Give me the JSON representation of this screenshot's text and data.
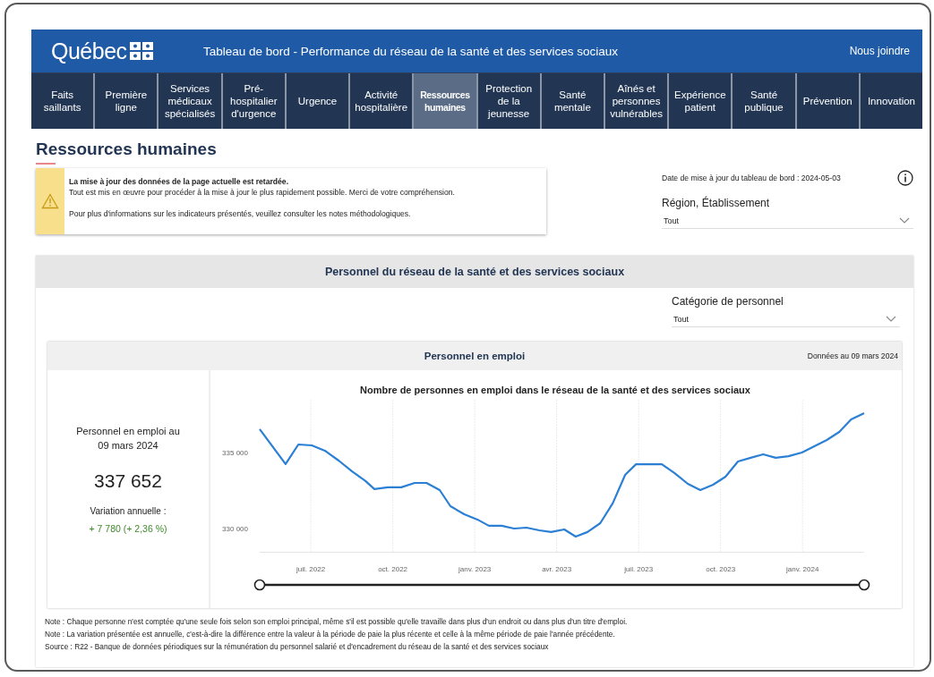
{
  "header": {
    "logo": "Québec",
    "title": "Tableau de bord - Performance du réseau de la santé et des services sociaux",
    "contact_link": "Nous joindre"
  },
  "nav": [
    {
      "label": "Faits saillants",
      "selected": false
    },
    {
      "label": "Première ligne",
      "selected": false
    },
    {
      "label": "Services médicaux spécialisés",
      "selected": false
    },
    {
      "label": "Pré-hospitalier d'urgence",
      "selected": false
    },
    {
      "label": "Urgence",
      "selected": false
    },
    {
      "label": "Activité hospitalière",
      "selected": false
    },
    {
      "label": "Ressources humaines",
      "selected": true
    },
    {
      "label": "Protection de la jeunesse",
      "selected": false
    },
    {
      "label": "Santé mentale",
      "selected": false
    },
    {
      "label": "Aînés et personnes vulnérables",
      "selected": false
    },
    {
      "label": "Expérience patient",
      "selected": false
    },
    {
      "label": "Santé publique",
      "selected": false
    },
    {
      "label": "Prévention",
      "selected": false
    },
    {
      "label": "Innovation",
      "selected": false
    }
  ],
  "page_title": "Ressources humaines",
  "alert": {
    "heading": "La mise à jour des données de la page actuelle est retardée.",
    "lines": [
      "Tout est mis en œuvre pour procéder à la mise à jour le plus rapidement possible. Merci de votre compréhension.",
      "Pour plus d'informations sur les indicateurs présentés, veuillez consulter les notes méthodologiques."
    ]
  },
  "update_date": "Date de mise à jour du tableau de bord : 2024-05-03",
  "region_filter": {
    "label": "Région, Établissement",
    "value": "Tout"
  },
  "section": {
    "title": "Personnel du réseau de la santé et des services sociaux",
    "category_filter": {
      "label": "Catégorie de personnel",
      "value": "Tout"
    },
    "panel": {
      "title": "Personnel en emploi",
      "data_date": "Données au 09 mars 2024",
      "kpi": {
        "label": "Personnel en emploi au 09 mars 2024",
        "value": "337 652",
        "variation_label": "Variation annuelle :",
        "variation": "+ 7 780 (+ 2,36 %)"
      },
      "chart_data": {
        "type": "line",
        "title": "Nombre de personnes en emploi dans le réseau de la santé et des services sociaux",
        "x": [
          2022.344,
          2022.423,
          2022.462,
          2022.503,
          2022.543,
          2022.585,
          2022.626,
          2022.667,
          2022.694,
          2022.735,
          2022.776,
          2022.817,
          2022.853,
          2022.893,
          2022.926,
          2022.968,
          2023.008,
          2023.043,
          2023.082,
          2023.12,
          2023.158,
          2023.197,
          2023.233,
          2023.273,
          2023.308,
          2023.344,
          2023.383,
          2023.421,
          2023.459,
          2023.492,
          2023.533,
          2023.571,
          2023.609,
          2023.65,
          2023.688,
          2023.727,
          2023.765,
          2023.803,
          2023.842,
          2023.88,
          2023.918,
          2023.957,
          2023.998,
          2024.036,
          2024.074,
          2024.112,
          2024.148,
          2024.188
        ],
        "series": [
          {
            "color": "#2b7fd4",
            "values": [
              336600,
              334300,
              335590,
              335530,
              335180,
              334530,
              333820,
              333180,
              332650,
              332770,
              332770,
              333060,
              333060,
              332590,
              331530,
              331000,
              330650,
              330240,
              330240,
              330060,
              330120,
              329940,
              329830,
              330000,
              329530,
              329830,
              330410,
              331710,
              333590,
              334290,
              334290,
              334290,
              333710,
              333000,
              332590,
              332940,
              333470,
              334470,
              334710,
              334940,
              334710,
              334820,
              335060,
              335470,
              335880,
              336410,
              337230,
              337652
            ]
          }
        ],
        "grid": true,
        "xlim": [
          2022.344,
          2024.188
        ],
        "ylim": [
          328500,
          338500
        ],
        "xticks": [
          {
            "value": 2022.5,
            "label": "juil. 2022"
          },
          {
            "value": 2022.75,
            "label": "oct. 2022"
          },
          {
            "value": 2023,
            "label": "janv. 2023"
          },
          {
            "value": 2023.25,
            "label": "avr. 2023"
          },
          {
            "value": 2023.5,
            "label": "juil. 2023"
          },
          {
            "value": 2023.75,
            "label": "oct. 2023"
          },
          {
            "value": 2024,
            "label": "janv. 2024"
          }
        ],
        "yticks": [
          {
            "value": 330000,
            "label": "330 000"
          },
          {
            "value": 335000,
            "label": "335 000"
          }
        ]
      }
    }
  },
  "notes": [
    "Note : Chaque personne n'est comptée qu'une seule fois selon son emploi principal, même s'il est possible qu'elle travaille dans plus d'un endroit ou dans plus d'un titre d'emploi.",
    "Note : La variation présentée est annuelle, c'est-à-dire la différence entre la valeur à la période de paie la plus récente et celle à la même période de paie l'année précédente.",
    "Source : R22 - Banque de données périodiques sur la rémunération du personnel salarié et d'encadrement du réseau de la santé et des services sociaux"
  ]
}
